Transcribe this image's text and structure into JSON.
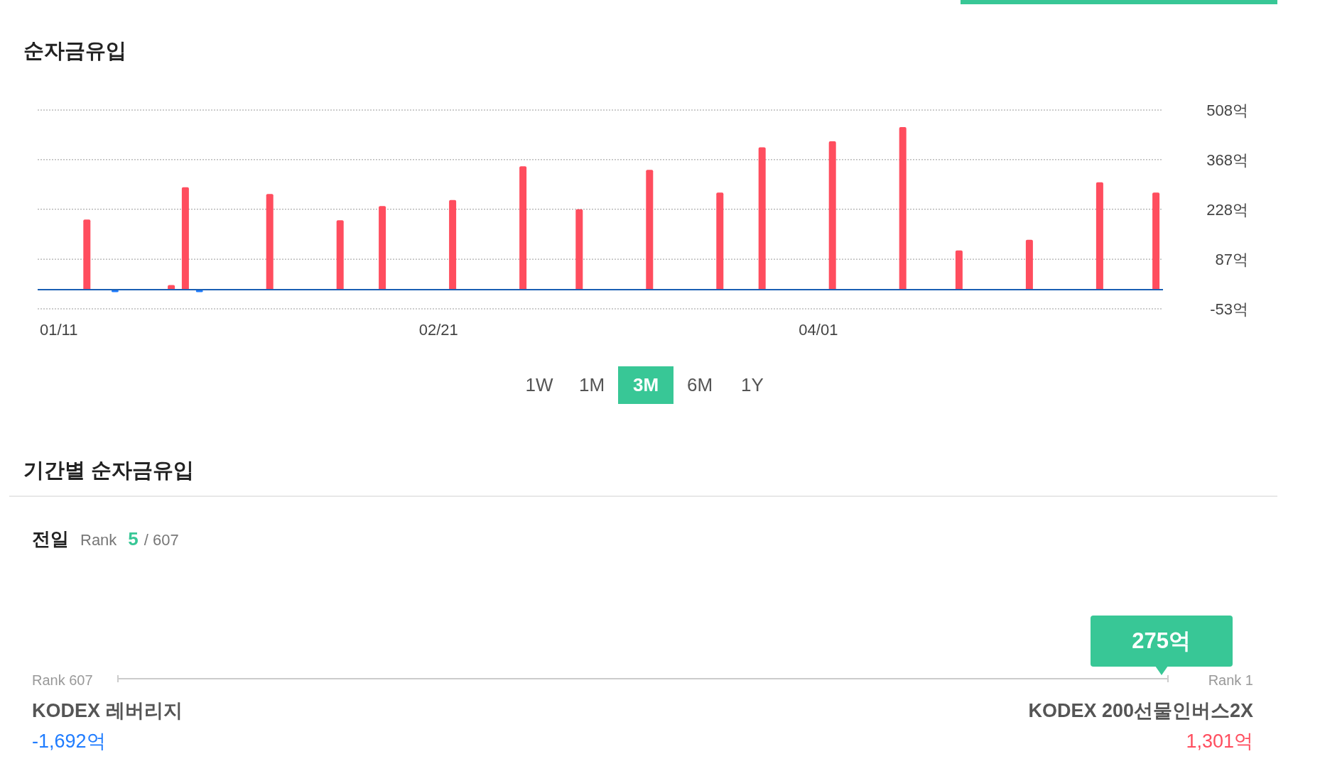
{
  "net_inflow": {
    "title": "순자금유입",
    "chart_data": {
      "type": "bar",
      "categories": [
        null,
        "01/11",
        null,
        null,
        null,
        null,
        null,
        null,
        null,
        null,
        null,
        null,
        null,
        null,
        null,
        null,
        null,
        null,
        null,
        null,
        null,
        null,
        null,
        null,
        null,
        null,
        null,
        null,
        "02/21",
        null,
        null,
        null,
        null,
        null,
        null,
        null,
        null,
        null,
        null,
        null,
        null,
        null,
        null,
        null,
        null,
        null,
        null,
        null,
        null,
        null,
        null,
        null,
        null,
        null,
        null,
        "04/01",
        null,
        null,
        null,
        null,
        null,
        null,
        null,
        null,
        null,
        null,
        null,
        null,
        null,
        null,
        null,
        null,
        null,
        null,
        null,
        null,
        null,
        null,
        null,
        null
      ],
      "grid": true,
      "stacked": true,
      "series": [
        {
          "color": "#ff4d5e",
          "values": [
            null,
            null,
            null,
            199,
            null,
            null,
            null,
            null,
            null,
            14,
            290,
            null,
            null,
            null,
            null,
            null,
            271,
            null,
            null,
            null,
            null,
            197,
            null,
            null,
            237,
            null,
            null,
            null,
            null,
            254,
            null,
            null,
            null,
            null,
            349,
            null,
            null,
            null,
            228,
            null,
            null,
            null,
            null,
            339,
            null,
            null,
            null,
            null,
            275,
            null,
            null,
            403,
            null,
            null,
            null,
            null,
            420,
            null,
            null,
            null,
            null,
            460,
            null,
            null,
            null,
            112,
            null,
            null,
            null,
            null,
            142,
            null,
            null,
            null,
            null,
            304,
            null,
            null,
            null,
            275
          ]
        },
        {
          "color": "#1f7cff",
          "values": [
            null,
            null,
            null,
            null,
            null,
            -6,
            null,
            null,
            null,
            null,
            null,
            -6,
            null,
            null,
            null,
            null,
            null,
            null,
            null,
            null,
            null,
            null,
            null,
            null,
            null,
            null,
            null,
            null,
            null,
            null,
            null,
            null,
            null,
            null,
            null,
            null,
            null,
            null,
            null,
            null,
            null,
            null,
            null,
            null,
            null,
            null,
            null,
            null,
            null,
            null,
            null,
            null,
            null,
            null,
            null,
            null,
            null,
            null,
            null,
            null,
            null,
            null,
            null,
            null,
            null,
            null,
            null,
            null,
            null,
            null,
            null,
            null,
            null,
            null,
            null,
            null,
            null,
            null,
            null,
            null
          ]
        }
      ],
      "ylim": [
        -53,
        508
      ],
      "yticks": [
        {
          "value": 508,
          "label": "508억"
        },
        {
          "value": 368,
          "label": "368억"
        },
        {
          "value": 228,
          "label": "228억"
        },
        {
          "value": 87,
          "label": "87억"
        },
        {
          "value": -53,
          "label": "-53억"
        }
      ]
    },
    "periods": [
      {
        "label": "1W",
        "selected": false
      },
      {
        "label": "1M",
        "selected": false
      },
      {
        "label": "3M",
        "selected": true
      },
      {
        "label": "6M",
        "selected": false
      },
      {
        "label": "1Y",
        "selected": false
      }
    ]
  },
  "period_inflow": {
    "title": "기간별 순자금유입",
    "day_label": "전일",
    "rank_label": "Rank",
    "rank": "5",
    "rank_total": "/ 607",
    "tooltip": "275억",
    "level": 0.993,
    "low_rank": "Rank 607",
    "high_rank": "Rank 1",
    "low_name": "KODEX 레버리지",
    "low_value": "-1,692억",
    "high_name": "KODEX 200선물인버스2X",
    "high_value": "1,301억"
  }
}
